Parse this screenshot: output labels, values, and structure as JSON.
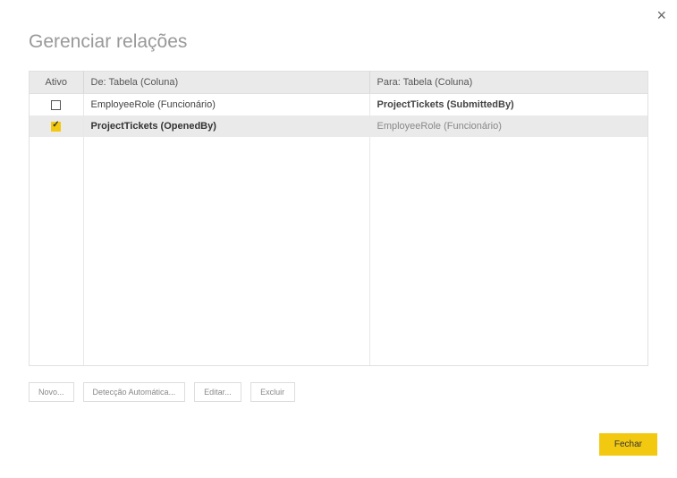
{
  "dialog": {
    "title": "Gerenciar relações",
    "close_icon": "×"
  },
  "table": {
    "headers": {
      "active": "Ativo",
      "from": "De: Tabela (Coluna)",
      "to": "Para: Tabela (Coluna)"
    },
    "rows": [
      {
        "active": false,
        "from": "EmployeeRole (Funcionário)",
        "to": "ProjectTickets (SubmittedBy)"
      },
      {
        "active": true,
        "from": "ProjectTickets (OpenedBy)",
        "to": "EmployeeRole (Funcionário)"
      }
    ]
  },
  "buttons": {
    "new": "Novo...",
    "auto": "Detecção Automática...",
    "edit": "Editar...",
    "delete": "Excluir",
    "close": "Fechar"
  }
}
